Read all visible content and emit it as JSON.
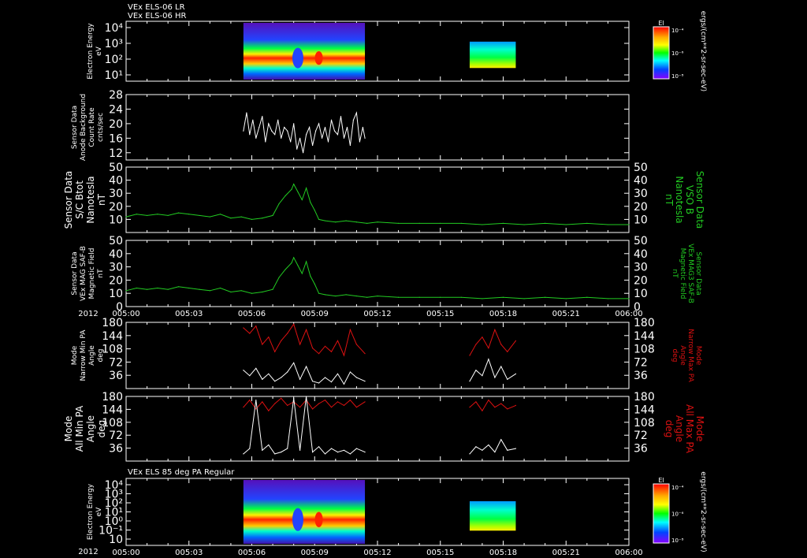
{
  "figure": {
    "year": "2012",
    "time_ticks": [
      "005:00",
      "005:03",
      "005:06",
      "005:09",
      "005:12",
      "005:15",
      "005:18",
      "005:21",
      "006:00"
    ]
  },
  "chart_data": [
    {
      "type": "heatmap",
      "panel_title_lines": [
        "VEx ELS-06 LR",
        "VEx ELS-06 HR"
      ],
      "ylabel_lines": [
        "Electron Energy",
        "eV"
      ],
      "yscale": "log",
      "yticks": [
        "10⁴",
        "10³",
        "10²",
        "10¹"
      ],
      "colorbar": {
        "title": "El",
        "ticks": [
          "10⁻⁴",
          "10⁻⁶",
          "10⁻⁸"
        ],
        "unit": "ergs/(cm**2-sr-sec-eV)"
      },
      "data_intervals_min": [
        [
          5.6,
          11.4
        ],
        [
          16.4,
          18.6
        ]
      ]
    },
    {
      "type": "line",
      "ylabel_lines": [
        "Sensor Data",
        "Anode Background",
        "Count Rate",
        "cnts/sec"
      ],
      "ylim": [
        10,
        28
      ],
      "yticks": [
        "28",
        "24",
        "20",
        "16",
        "12"
      ],
      "series": [
        {
          "color": "#ffffff",
          "x": [
            5.6,
            5.75,
            5.9,
            6.05,
            6.2,
            6.35,
            6.5,
            6.65,
            6.8,
            6.95,
            7.1,
            7.25,
            7.4,
            7.55,
            7.7,
            7.85,
            8.0,
            8.15,
            8.3,
            8.45,
            8.6,
            8.75,
            8.9,
            9.05,
            9.2,
            9.35,
            9.5,
            9.65,
            9.8,
            9.95,
            10.1,
            10.25,
            10.4,
            10.55,
            10.7,
            10.85,
            11.0,
            11.15,
            11.3,
            11.4
          ],
          "y": [
            18,
            23,
            17,
            21,
            16,
            19,
            22,
            15,
            20,
            18,
            17,
            21,
            16,
            19,
            18,
            15,
            20,
            13,
            16,
            12,
            17,
            19,
            14,
            18,
            20,
            16,
            19,
            15,
            21,
            18,
            17,
            22,
            16,
            19,
            14,
            21,
            23,
            15,
            19,
            16
          ]
        }
      ]
    },
    {
      "type": "line",
      "ylabel_lines": [
        "Sensor Data",
        "S/C Btot",
        "Nanotesla",
        "nT"
      ],
      "right_label_lines": [
        "Sensor Data",
        "VSO B",
        "Nanotesla",
        "nT"
      ],
      "ylim": [
        0,
        50
      ],
      "yticks": [
        "50",
        "40",
        "30",
        "20",
        "10"
      ],
      "series": [
        {
          "color": "#22cc22",
          "x": [
            0,
            0.5,
            1,
            1.5,
            2,
            2.5,
            3,
            3.5,
            4,
            4.5,
            5,
            5.5,
            6,
            6.5,
            7,
            7.3,
            7.6,
            7.9,
            8.0,
            8.2,
            8.4,
            8.6,
            8.8,
            9.0,
            9.2,
            9.5,
            10,
            10.5,
            11,
            11.5,
            12,
            13,
            14,
            15,
            16,
            17,
            18,
            19,
            20,
            21,
            22,
            23,
            24
          ],
          "y": [
            12,
            14,
            13,
            14,
            13,
            15,
            14,
            13,
            12,
            14,
            11,
            12,
            10,
            11,
            13,
            22,
            28,
            33,
            37,
            31,
            25,
            34,
            23,
            17,
            10,
            9,
            8,
            9,
            8,
            7,
            8,
            7,
            7,
            7,
            7,
            6,
            7,
            6,
            7,
            6,
            7,
            6,
            6
          ]
        }
      ]
    },
    {
      "type": "line",
      "ylabel_lines": [
        "Sensor Data",
        "VEx MAG SAF-B",
        "Magnetic Field",
        "nT"
      ],
      "right_label_lines": [
        "Sensor Data",
        "VEx MAG3 SAF-B",
        "Magnetic Field",
        "nT"
      ],
      "ylim": [
        0,
        50
      ],
      "yticks": [
        "50",
        "40",
        "30",
        "20",
        "10",
        "0"
      ],
      "series": [
        {
          "color": "#22cc22",
          "x": [
            0,
            0.5,
            1,
            1.5,
            2,
            2.5,
            3,
            3.5,
            4,
            4.5,
            5,
            5.5,
            6,
            6.5,
            7,
            7.3,
            7.6,
            7.9,
            8.0,
            8.2,
            8.4,
            8.6,
            8.8,
            9.0,
            9.2,
            9.5,
            10,
            10.5,
            11,
            11.5,
            12,
            13,
            14,
            15,
            16,
            17,
            18,
            19,
            20,
            21,
            22,
            23,
            24
          ],
          "y": [
            12,
            14,
            13,
            14,
            13,
            15,
            14,
            13,
            12,
            14,
            11,
            12,
            10,
            11,
            13,
            22,
            28,
            33,
            37,
            31,
            25,
            34,
            23,
            17,
            10,
            9,
            8,
            9,
            8,
            7,
            8,
            7,
            7,
            7,
            7,
            6,
            7,
            6,
            7,
            6,
            7,
            6,
            6
          ]
        }
      ]
    },
    {
      "type": "line",
      "ylabel_lines": [
        "Mode",
        "Narrow Min PA",
        "Angle",
        "deg"
      ],
      "right_label_lines": [
        "Mode",
        "Narrow Max PA",
        "Angle",
        "deg"
      ],
      "ylim": [
        0,
        180
      ],
      "yticks": [
        "180",
        "144",
        "108",
        "72",
        "36"
      ],
      "series": [
        {
          "color": "#dd1111",
          "x": [
            5.6,
            5.9,
            6.2,
            6.5,
            6.8,
            7.1,
            7.4,
            7.7,
            8.0,
            8.3,
            8.6,
            8.9,
            9.2,
            9.5,
            9.8,
            10.1,
            10.4,
            10.7,
            11.0,
            11.4
          ],
          "y": [
            165,
            150,
            170,
            120,
            140,
            100,
            130,
            150,
            175,
            120,
            160,
            110,
            95,
            115,
            100,
            130,
            90,
            160,
            120,
            95
          ]
        },
        {
          "color": "#ffffff",
          "x": [
            5.6,
            5.9,
            6.2,
            6.5,
            6.8,
            7.1,
            7.4,
            7.7,
            8.0,
            8.3,
            8.6,
            8.9,
            9.2,
            9.5,
            9.8,
            10.1,
            10.4,
            10.7,
            11.0,
            11.4
          ],
          "y": [
            50,
            35,
            55,
            25,
            40,
            20,
            30,
            45,
            70,
            25,
            60,
            20,
            15,
            30,
            18,
            40,
            12,
            45,
            30,
            20
          ]
        },
        {
          "color": "#dd1111",
          "x": [
            16.4,
            16.7,
            17.0,
            17.3,
            17.6,
            17.9,
            18.2,
            18.6
          ],
          "y": [
            90,
            120,
            140,
            110,
            160,
            120,
            100,
            130
          ]
        },
        {
          "color": "#ffffff",
          "x": [
            16.4,
            16.7,
            17.0,
            17.3,
            17.6,
            17.9,
            18.2,
            18.6
          ],
          "y": [
            20,
            50,
            35,
            80,
            30,
            60,
            25,
            40
          ]
        }
      ]
    },
    {
      "type": "line",
      "ylabel_lines": [
        "Mode",
        "All Min PA",
        "Angle",
        "deg"
      ],
      "right_label_lines": [
        "Mode",
        "All Max PA",
        "Angle",
        "deg"
      ],
      "ylim": [
        0,
        180
      ],
      "yticks": [
        "180",
        "144",
        "108",
        "72",
        "36"
      ],
      "series": [
        {
          "color": "#dd1111",
          "x": [
            5.6,
            5.9,
            6.2,
            6.5,
            6.8,
            7.1,
            7.4,
            7.7,
            8.0,
            8.3,
            8.6,
            8.9,
            9.2,
            9.5,
            9.8,
            10.1,
            10.4,
            10.7,
            11.0,
            11.4
          ],
          "y": [
            150,
            170,
            145,
            165,
            140,
            160,
            175,
            155,
            165,
            150,
            170,
            145,
            160,
            170,
            150,
            165,
            155,
            170,
            150,
            165
          ]
        },
        {
          "color": "#ffffff",
          "x": [
            5.6,
            5.9,
            6.2,
            6.5,
            6.8,
            7.1,
            7.4,
            7.7,
            8.0,
            8.3,
            8.6,
            8.9,
            9.2,
            9.5,
            9.8,
            10.1,
            10.4,
            10.7,
            11.0,
            11.4
          ],
          "y": [
            20,
            35,
            170,
            30,
            45,
            20,
            25,
            35,
            175,
            30,
            180,
            25,
            40,
            20,
            35,
            25,
            30,
            20,
            35,
            25
          ]
        },
        {
          "color": "#dd1111",
          "x": [
            16.4,
            16.7,
            17.0,
            17.3,
            17.6,
            17.9,
            18.2,
            18.6
          ],
          "y": [
            150,
            165,
            140,
            170,
            150,
            160,
            145,
            155
          ]
        },
        {
          "color": "#ffffff",
          "x": [
            16.4,
            16.7,
            17.0,
            17.3,
            17.6,
            17.9,
            18.2,
            18.6
          ],
          "y": [
            20,
            40,
            30,
            45,
            25,
            60,
            30,
            35
          ]
        }
      ]
    },
    {
      "type": "heatmap",
      "panel_title_lines": [
        "VEx ELS 85 deg PA Regular"
      ],
      "ylabel_lines": [
        "Electron Energy",
        "eV"
      ],
      "yscale": "log",
      "yticks": [
        "10⁴",
        "10³",
        "10²",
        "10¹",
        "10⁰",
        "10⁻¹",
        "10"
      ],
      "colorbar": {
        "title": "El",
        "ticks": [
          "10⁻⁴",
          "10⁻⁶",
          "10⁻⁸"
        ],
        "unit": "ergs/(cm**2-sr-sec-eV)"
      },
      "data_intervals_min": [
        [
          5.6,
          11.4
        ],
        [
          16.4,
          18.6
        ]
      ]
    }
  ]
}
